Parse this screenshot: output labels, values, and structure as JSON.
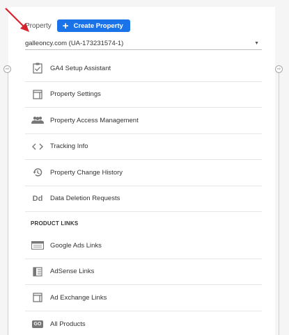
{
  "property": {
    "label": "Property",
    "create_button": "Create Property",
    "selected": "galleoncy.com (UA-173231574-1)"
  },
  "menu_items": [
    {
      "label": "GA4 Setup Assistant",
      "icon": "clipboard-check-icon"
    },
    {
      "label": "Property Settings",
      "icon": "window-icon"
    },
    {
      "label": "Property Access Management",
      "icon": "people-icon"
    },
    {
      "label": "Tracking Info",
      "icon": "code-brackets-icon"
    },
    {
      "label": "Property Change History",
      "icon": "history-icon"
    },
    {
      "label": "Data Deletion Requests",
      "icon": "dd-icon",
      "icon_text": "Dd"
    }
  ],
  "product_links": {
    "header": "PRODUCT LINKS",
    "items": [
      {
        "label": "Google Ads Links",
        "icon": "google-ads-icon"
      },
      {
        "label": "AdSense Links",
        "icon": "adsense-icon"
      },
      {
        "label": "Ad Exchange Links",
        "icon": "ad-exchange-icon"
      },
      {
        "label": "All Products",
        "icon": "all-products-icon",
        "icon_text": "GO"
      }
    ]
  },
  "colors": {
    "accent": "#1a73e8",
    "annotation_arrow": "#d9232d"
  }
}
